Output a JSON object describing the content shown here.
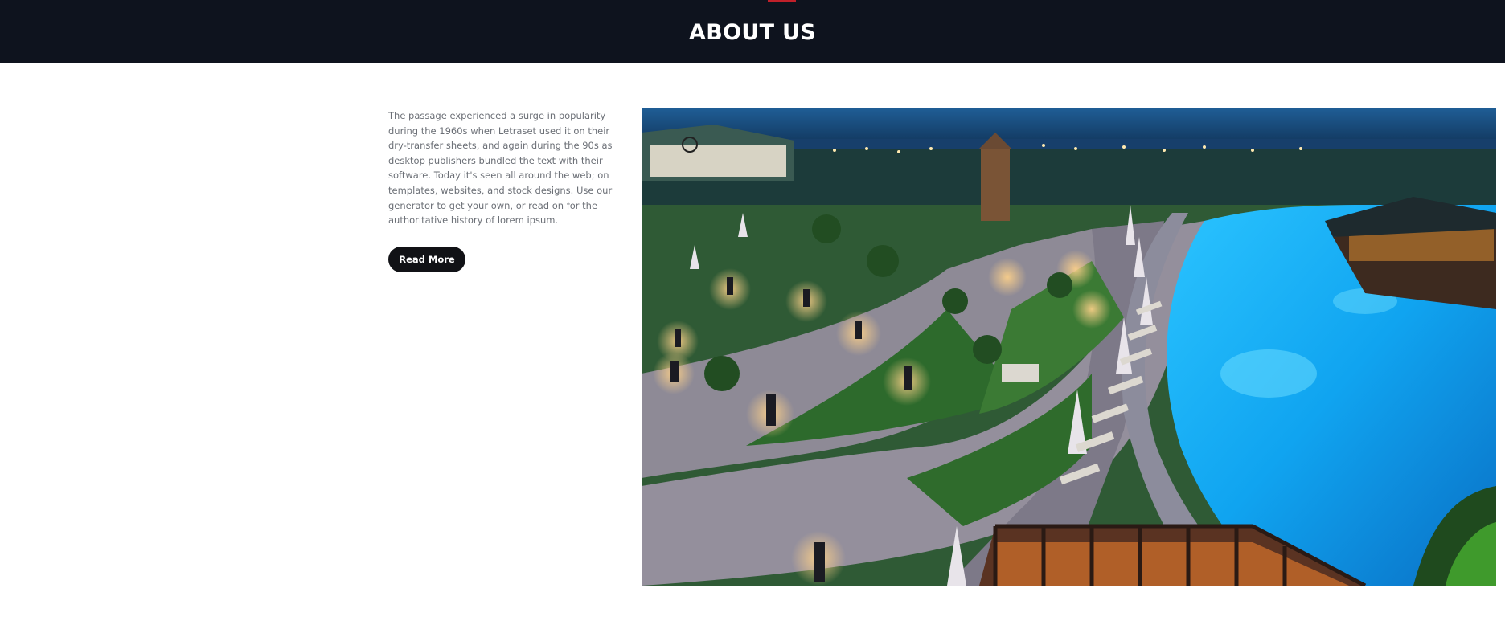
{
  "header": {
    "title": "ABOUT US"
  },
  "about": {
    "paragraph": "The passage experienced a surge in popularity during the 1960s when Letraset used it on their dry-transfer sheets, and again during the 90s as desktop publishers bundled the text with their software. Today it's seen all around the web; on templates, websites, and stock designs. Use our generator to get your own, or read on for the authoritative history of lorem ipsum.",
    "button_label": "Read More"
  },
  "photo": {
    "subject": "resort-pool-night-photo"
  },
  "colors": {
    "header_bg": "#0e131e",
    "accent": "#c0202a",
    "button_bg": "#111216",
    "body_text": "#6b6f76"
  }
}
